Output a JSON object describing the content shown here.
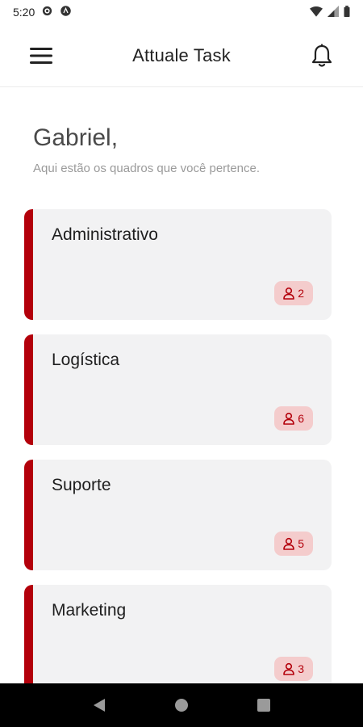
{
  "status_bar": {
    "time": "5:20"
  },
  "app_bar": {
    "title": "Attuale Task"
  },
  "greeting": {
    "name": "Gabriel,",
    "subtitle": "Aqui estão os quadros que você pertence."
  },
  "boards": [
    {
      "title": "Administrativo",
      "members": "2"
    },
    {
      "title": "Logística",
      "members": "6"
    },
    {
      "title": "Suporte",
      "members": "5"
    },
    {
      "title": "Marketing",
      "members": "3"
    }
  ],
  "colors": {
    "accent": "#b3000b",
    "card_bg": "#f2f2f3",
    "badge_bg": "#f4cccc"
  },
  "icons": {
    "menu": "hamburger-menu-icon",
    "notifications": "bell-icon",
    "members": "person-icon"
  }
}
